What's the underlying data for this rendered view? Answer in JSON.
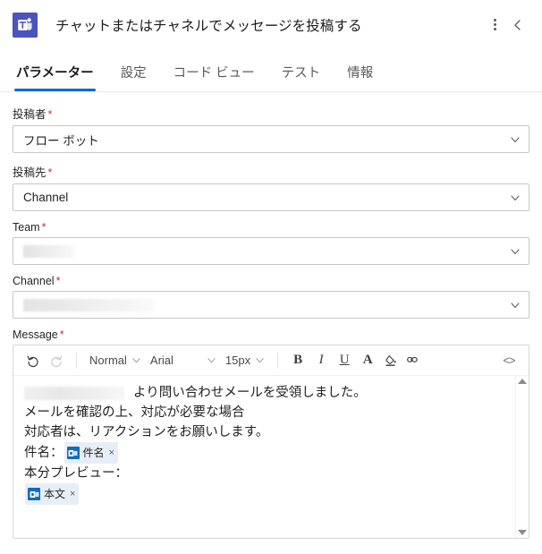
{
  "header": {
    "app_icon": "microsoft-teams-icon",
    "title": "チャットまたはチャネルでメッセージを投稿する",
    "more_menu": "more-options-icon",
    "collapse": "chevron-left-icon"
  },
  "tabs": [
    {
      "label": "パラメーター",
      "active": true
    },
    {
      "label": "設定",
      "active": false
    },
    {
      "label": "コード ビュー",
      "active": false
    },
    {
      "label": "テスト",
      "active": false
    },
    {
      "label": "情報",
      "active": false
    }
  ],
  "fields": {
    "poster": {
      "label": "投稿者",
      "required": "*",
      "value": "フロー ボット"
    },
    "post_to": {
      "label": "投稿先",
      "required": "*",
      "value": "Channel"
    },
    "team": {
      "label": "Team",
      "required": "*",
      "value": ""
    },
    "channel": {
      "label": "Channel",
      "required": "*",
      "value": ""
    },
    "message": {
      "label": "Message",
      "required": "*"
    }
  },
  "toolbar": {
    "undo": "undo-icon",
    "redo": "redo-icon",
    "style": "Normal",
    "font": "Arial",
    "size": "15px",
    "bold": "B",
    "italic": "I",
    "underline": "U",
    "font_color": "A",
    "highlight": "highlight-icon",
    "link": "link-icon",
    "code_view": "<>"
  },
  "message_body": {
    "line1_suffix": "より問い合わせメールを受領しました。",
    "line2": "メールを確認の上、対応が必要な場合",
    "line3": "対応者は、リアクションをお願いします。",
    "line4_label": "件名：",
    "token_subject": "件名",
    "line5_label": "本分プレビュー：",
    "token_body": "本文",
    "token_remove": "×"
  },
  "colors": {
    "accent": "#1268d2",
    "teams_purple": "#4b53bc",
    "required_red": "#c4314b",
    "token_blue": "#0f6cbd"
  }
}
